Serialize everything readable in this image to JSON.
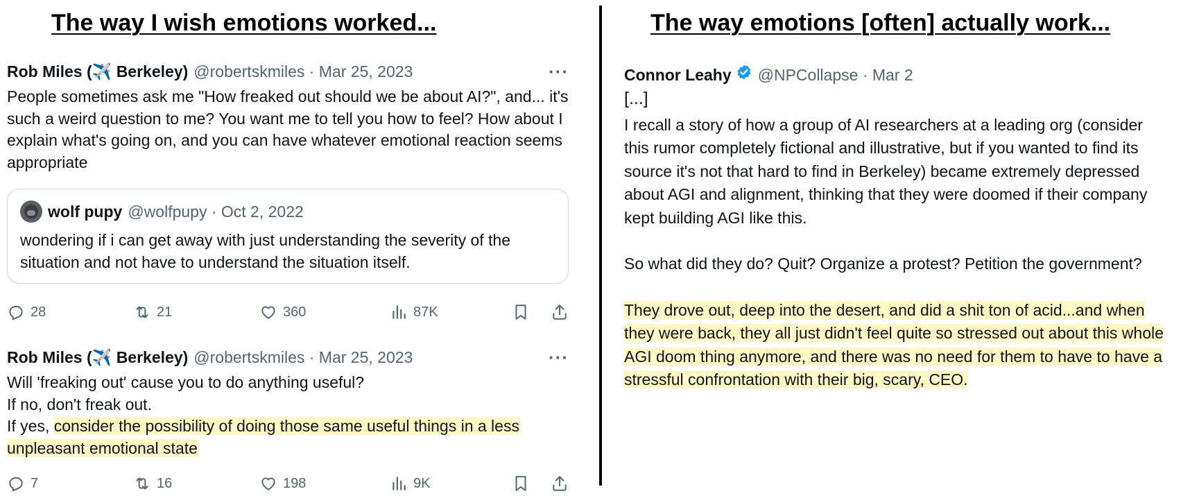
{
  "headings": {
    "left": "The way I wish emotions worked...",
    "right": "The way emotions [often] actually work..."
  },
  "tweet1": {
    "name": "Rob Miles (✈️ Berkeley)",
    "handle_date": "@robertskmiles · Mar 25, 2023",
    "more": "···",
    "text": "People sometimes ask me \"How freaked out should we be about AI?\", and... it's such a weird question to me? You want me to tell you how to feel? How about I explain what's going on, and you can have whatever emotional reaction seems appropriate",
    "quote": {
      "name": "wolf pupy",
      "handle_date": "@wolfpupy · Oct 2, 2022",
      "text": "wondering if i can get away with just understanding the severity of the situation and not have to understand the situation itself."
    },
    "actions": {
      "replies": "28",
      "retweets": "21",
      "likes": "360",
      "views": "87K"
    }
  },
  "tweet2": {
    "name": "Rob Miles (✈️ Berkeley)",
    "handle_date": "@robertskmiles · Mar 25, 2023",
    "more": "···",
    "line1": "Will 'freaking out' cause you to do anything useful?",
    "line2": "If no, don't freak out.",
    "line3_prefix": "If yes, ",
    "line3_highlight": "consider the possibility of doing those same useful things in a less unpleasant emotional state",
    "actions": {
      "replies": "7",
      "retweets": "16",
      "likes": "198",
      "views": "9K"
    }
  },
  "tweet3": {
    "name": "Connor Leahy",
    "handle_date": "@NPCollapse · Mar 2",
    "ellipsis": "[...]",
    "para1": "I recall a story of how a group of AI researchers at a leading org (consider this rumor completely fictional and illustrative, but if you wanted to find its source it's not that hard to find in Berkeley) became extremely depressed about AGI and alignment, thinking that they were doomed if their company kept building AGI like this.",
    "para2": "So what did they do? Quit? Organize a protest? Petition the government?",
    "para3_highlight": "They drove out, deep into the desert, and did a shit ton of acid...and when they were back, they all just didn't feel quite so stressed out about this whole AGI doom thing anymore, and there was no need for them to have to have a stressful confrontation with their big, scary, CEO."
  },
  "colors": {
    "highlight": "#fdf8c6",
    "verified": "#1d9bf0",
    "muted": "#536471"
  }
}
